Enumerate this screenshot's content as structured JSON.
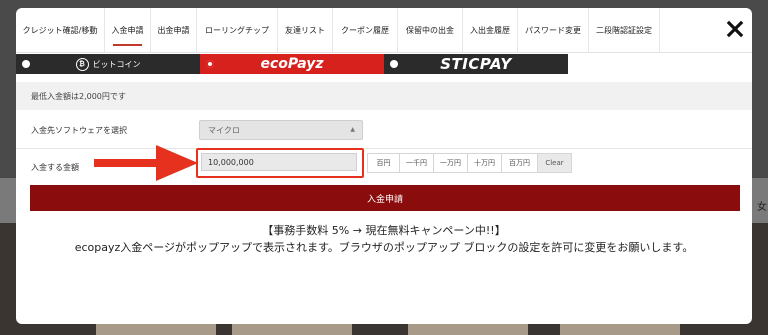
{
  "tabs": [
    {
      "label": "クレジット確認/移動",
      "active": false
    },
    {
      "label": "入金申請",
      "active": true
    },
    {
      "label": "出金申請",
      "active": false
    },
    {
      "label": "ローリングチップ",
      "active": false
    },
    {
      "label": "友達リスト",
      "active": false
    },
    {
      "label": "クーポン履歴",
      "active": false
    },
    {
      "label": "保留中の出金",
      "active": false
    },
    {
      "label": "入出金履歴",
      "active": false
    },
    {
      "label": "パスワード変更",
      "active": false
    },
    {
      "label": "二段階認証設定",
      "active": false
    }
  ],
  "payment_methods": [
    {
      "label": "ビットコイン",
      "icon": "bitcoin-icon",
      "selected": false
    },
    {
      "label": "ecoPayz",
      "selected": true
    },
    {
      "label": "STICPAY",
      "selected": false
    }
  ],
  "min_note": "最低入金額は2,000円です",
  "software": {
    "label": "入金先ソフトウェアを選択",
    "selected": "マイクロ"
  },
  "amount": {
    "label": "入金する金額",
    "value": "10,000,000"
  },
  "unit_buttons": [
    "百円",
    "一千円",
    "一万円",
    "十万円",
    "百万円",
    "Clear"
  ],
  "submit_label": "入金申請",
  "notice": {
    "line1": "【事務手数料 5% → 現在無料キャンペーン中!!】",
    "line2": "ecopayz入金ページがポップアップで表示されます。ブラウザのポップアップ ブロックの設定を許可に変更をお願いします。"
  },
  "background_right_label": "女",
  "colors": {
    "accent_red": "#d7211c",
    "submit_red": "#8b0c0c",
    "annotation_red": "#e5311d",
    "dark_bar": "#2b2b2b"
  }
}
